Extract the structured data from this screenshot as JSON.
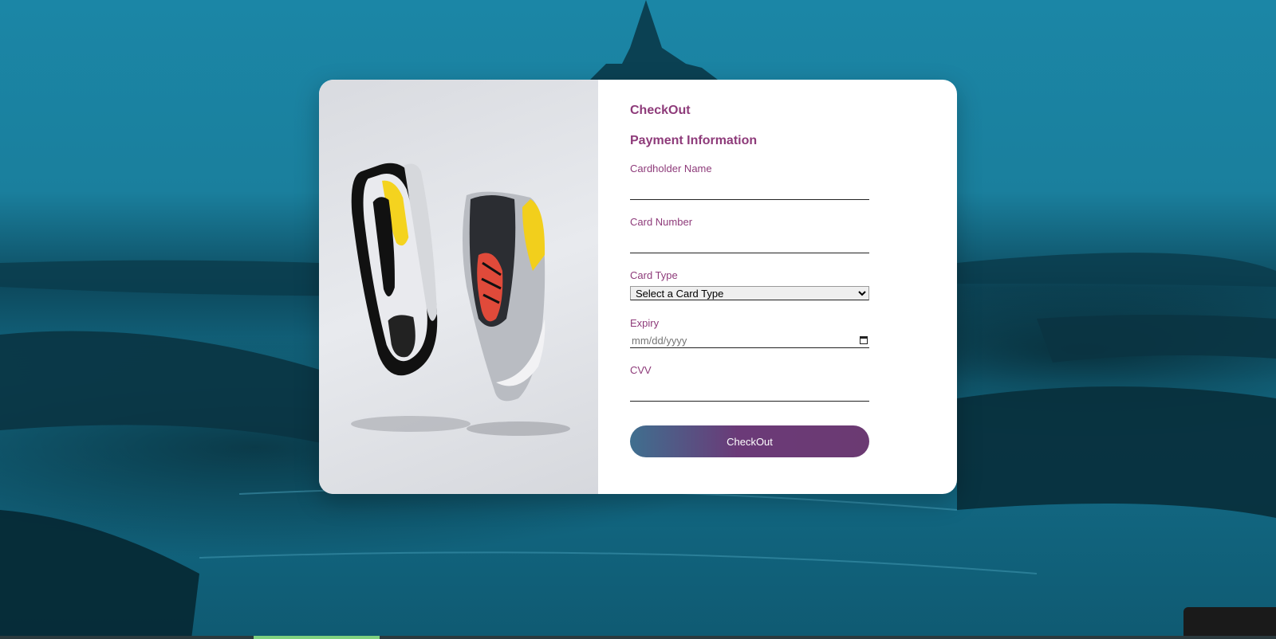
{
  "form": {
    "title": "CheckOut",
    "subtitle": "Payment Information",
    "cardholder_label": "Cardholder Name",
    "card_number_label": "Card Number",
    "card_type_label": "Card Type",
    "card_type_selected": "Select a Card Type",
    "expiry_label": "Expiry",
    "expiry_placeholder": "mm/dd/yyyy",
    "cvv_label": "CVV",
    "submit_label": "CheckOut"
  },
  "colors": {
    "accent": "#8e3b7a",
    "button_gradient_start": "#3f6f8f",
    "button_gradient_end": "#6b3a72"
  }
}
